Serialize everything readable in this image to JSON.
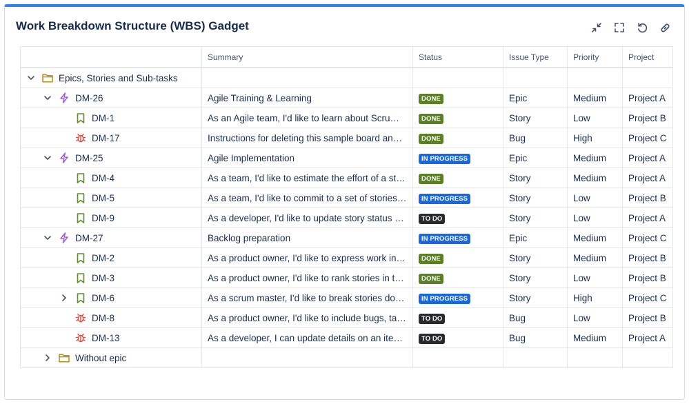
{
  "gadget": {
    "title": "Work Breakdown Structure (WBS) Gadget"
  },
  "toolbar": {
    "icons": [
      "collapse-icon",
      "fullscreen-icon",
      "refresh-icon",
      "link-icon"
    ]
  },
  "table": {
    "columns": [
      "",
      "Summary",
      "Status",
      "Issue Type",
      "Priority",
      "Project"
    ],
    "status_colors": {
      "DONE": "#5b7f24",
      "IN PROGRESS": "#1868db",
      "TO DO": "#292a2e"
    },
    "rows": [
      {
        "level": 0,
        "chevron": "down",
        "icon": "folder-icon",
        "key": "Epics, Stories and Sub-tasks",
        "summary": "",
        "status": "",
        "type": "",
        "priority": "",
        "project": ""
      },
      {
        "level": 1,
        "chevron": "down",
        "icon": "epic-icon",
        "key": "DM-26",
        "summary": "Agile Training & Learning",
        "status": "DONE",
        "type": "Epic",
        "priority": "Medium",
        "project": "Project A"
      },
      {
        "level": 2,
        "chevron": "",
        "icon": "story-icon",
        "key": "DM-1",
        "summary": "As an Agile team, I'd like to learn about Scrum ...",
        "status": "DONE",
        "type": "Story",
        "priority": "Low",
        "project": "Project B"
      },
      {
        "level": 2,
        "chevron": "",
        "icon": "bug-icon",
        "key": "DM-17",
        "summary": "Instructions for deleting this sample board and ...",
        "status": "DONE",
        "type": "Bug",
        "priority": "High",
        "project": "Project C"
      },
      {
        "level": 1,
        "chevron": "down",
        "icon": "epic-icon",
        "key": "DM-25",
        "summary": "Agile Implementation",
        "status": "IN PROGRESS",
        "type": "Epic",
        "priority": "Medium",
        "project": "Project A"
      },
      {
        "level": 2,
        "chevron": "",
        "icon": "story-icon",
        "key": "DM-4",
        "summary": "As a team, I'd like to estimate the effort of a sto...",
        "status": "DONE",
        "type": "Story",
        "priority": "Medium",
        "project": "Project A"
      },
      {
        "level": 2,
        "chevron": "",
        "icon": "story-icon",
        "key": "DM-5",
        "summary": "As a team, I'd like to commit to a set of stories t...",
        "status": "IN PROGRESS",
        "type": "Story",
        "priority": "Low",
        "project": "Project B"
      },
      {
        "level": 2,
        "chevron": "",
        "icon": "story-icon",
        "key": "DM-9",
        "summary": "As a developer, I'd like to update story status d...",
        "status": "TO DO",
        "type": "Story",
        "priority": "Low",
        "project": "Project A"
      },
      {
        "level": 1,
        "chevron": "down",
        "icon": "epic-icon",
        "key": "DM-27",
        "summary": "Backlog preparation",
        "status": "IN PROGRESS",
        "type": "Epic",
        "priority": "Medium",
        "project": "Project C"
      },
      {
        "level": 2,
        "chevron": "",
        "icon": "story-icon",
        "key": "DM-2",
        "summary": "As a product owner, I'd like to express work in t...",
        "status": "DONE",
        "type": "Story",
        "priority": "Medium",
        "project": "Project B"
      },
      {
        "level": 2,
        "chevron": "",
        "icon": "story-icon",
        "key": "DM-3",
        "summary": "As a product owner, I'd like to rank stories in th...",
        "status": "DONE",
        "type": "Story",
        "priority": "Low",
        "project": "Project B"
      },
      {
        "level": 2,
        "chevron": "right",
        "icon": "story-icon",
        "key": "DM-6",
        "summary": "As a scrum master, I'd like to break stories dow...",
        "status": "IN PROGRESS",
        "type": "Story",
        "priority": "High",
        "project": "Project C"
      },
      {
        "level": 2,
        "chevron": "",
        "icon": "bug-icon",
        "key": "DM-8",
        "summary": "As a product owner, I'd like to include bugs, tas...",
        "status": "TO DO",
        "type": "Bug",
        "priority": "Low",
        "project": "Project B"
      },
      {
        "level": 2,
        "chevron": "",
        "icon": "bug-icon",
        "key": "DM-13",
        "summary": "As a developer, I can update details on an item ...",
        "status": "TO DO",
        "type": "Bug",
        "priority": "Medium",
        "project": "Project A"
      },
      {
        "level": 1,
        "chevron": "right",
        "icon": "folder-icon",
        "key": "Without epic",
        "summary": "",
        "status": "",
        "type": "",
        "priority": "",
        "project": ""
      }
    ]
  }
}
